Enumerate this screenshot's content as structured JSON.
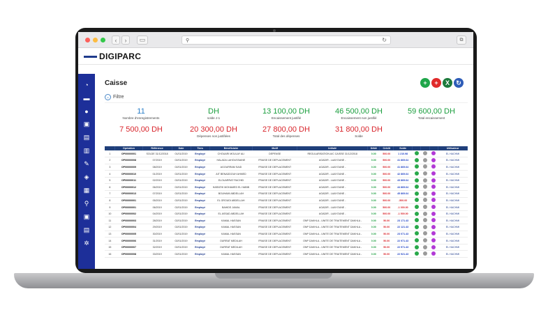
{
  "browser": {
    "url": "",
    "reload_icon": "reload-icon"
  },
  "app": {
    "brand": "DIGIPARC"
  },
  "sidebar": {
    "items": [
      {
        "icon": "dashboard-icon",
        "glyph": "◔"
      },
      {
        "icon": "car-icon",
        "glyph": "▬"
      },
      {
        "icon": "user-icon",
        "glyph": "●"
      },
      {
        "icon": "bus-icon",
        "glyph": "▣"
      },
      {
        "icon": "document-icon",
        "glyph": "▤"
      },
      {
        "icon": "fuel-icon",
        "glyph": "▥"
      },
      {
        "icon": "wrench-icon",
        "glyph": "✎"
      },
      {
        "icon": "layers-icon",
        "glyph": "◈"
      },
      {
        "icon": "building-icon",
        "glyph": "▦"
      },
      {
        "icon": "location-icon",
        "glyph": "⚲"
      },
      {
        "icon": "vehicle-icon",
        "glyph": "▣"
      },
      {
        "icon": "report-icon",
        "glyph": "▤"
      },
      {
        "icon": "settings-icon",
        "glyph": "✲"
      }
    ]
  },
  "page": {
    "title": "Caisse",
    "filter_label": "Filtre"
  },
  "actions": [
    {
      "icon": "add-icon",
      "glyph": "+",
      "color": "#1fa64a"
    },
    {
      "icon": "add-expense-icon",
      "glyph": "+",
      "color": "#e02a2a"
    },
    {
      "icon": "excel-icon",
      "glyph": "X",
      "color": "#1d7a3c"
    },
    {
      "icon": "refresh-icon",
      "glyph": "↻",
      "color": "#2e5db8"
    }
  ],
  "stats_row1": [
    {
      "value": "11",
      "label": "Nombre d'enregistrements",
      "color": "#2a7fc9"
    },
    {
      "value": "DH",
      "label": "solde J-1",
      "color": "#1b9e3e"
    },
    {
      "value": "13 100,00 DH",
      "label": "Encaissement justifié",
      "color": "#1b9e3e"
    },
    {
      "value": "46 500,00 DH",
      "label": "Encaissement non justifié",
      "color": "#1b9e3e"
    },
    {
      "value": "59 600,00 DH",
      "label": "Total encaissement",
      "color": "#1b9e3e"
    }
  ],
  "stats_row2": [
    {
      "value": "7 500,00 DH",
      "label": "",
      "color": "#d8232a"
    },
    {
      "value": "20 300,00 DH",
      "label": "Dépenses non justifiées",
      "color": "#d8232a"
    },
    {
      "value": "27 800,00 DH",
      "label": "Total des dépenses",
      "color": "#d8232a"
    },
    {
      "value": "31 800,00 DH",
      "label": "Solde",
      "color": "#d8232a"
    }
  ],
  "table": {
    "headers": [
      "",
      "Opération",
      "Référence",
      "Date",
      "Tiers",
      "Bénéficiaire",
      "Motif",
      "Intitulé",
      "Débit",
      "Crédit",
      "Solde",
      "",
      "",
      "",
      "Utilisateur"
    ],
    "rows": [
      [
        "1",
        "OP00000001",
        "SOLDE 31/12/2018",
        "01/01/2019",
        "Employé",
        "CHOUARI MOULAY ALI",
        "DEPENSE",
        "REGULARISATION A/C CAISSE 31/12/2018",
        "0.00",
        "500.00",
        "1 210.98",
        "EL HACHMI"
      ],
      [
        "2",
        "OP00000008",
        "07/2019",
        "02/01/2019",
        "Employé",
        "HALADA LAHOUSSAINE",
        "FRAISE DE DEPLACEMENT",
        "AGADIR - LAAYOUNE -",
        "0.00",
        "500.00",
        "41 869.64",
        "EL HACHMI"
      ],
      [
        "3",
        "OP00000009",
        "08/2019",
        "02/01/2019",
        "Employé",
        "AGOURRAM SAID",
        "FRAISE DE DEPLACEMENT",
        "AGADIR - LAAYOUNE -",
        "0.00",
        "500.00",
        "41 869.64",
        "EL HACHMI"
      ],
      [
        "4",
        "OP00000010",
        "01/2019",
        "02/01/2019",
        "Employé",
        "AIT BENADDOUH AHMED",
        "FRAISE DE DEPLACEMENT",
        "AGADIR - LAAYOUNE -",
        "0.00",
        "500.00",
        "42 869.64",
        "EL HACHMI"
      ],
      [
        "5",
        "OP00000011",
        "02/2019",
        "02/01/2019",
        "Employé",
        "ELOUARRAT RACHID",
        "FRAISE DE DEPLACEMENT",
        "AGADIR - LAAYOUNE -",
        "0.00",
        "500.00",
        "43 869.64",
        "EL HACHMI"
      ],
      [
        "6",
        "OP00000012",
        "06/2019",
        "02/01/2019",
        "Employé",
        "HARATHI MOHAMED EL HABIB",
        "FRAISE DE DEPLACEMENT",
        "AGADIR - LAAYOUNE -",
        "0.00",
        "500.00",
        "44 869.64",
        "EL HACHMI"
      ],
      [
        "7",
        "OP00000013",
        "07/2019",
        "02/01/2019",
        "Employé",
        "BOUHAMI ABDELLAH",
        "FRAISE DE DEPLACEMENT",
        "AGADIR - LAAYOUNE -",
        "0.00",
        "500.00",
        "45 869.64",
        "EL HACHMI"
      ],
      [
        "8",
        "OP00000001",
        "05/2019",
        "02/01/2019",
        "Employé",
        "EL GROUDI ABDELLAH",
        "FRAISE DE DEPLACEMENT",
        "AGADIR - LAAYOUNE -",
        "0.00",
        "500.00",
        "-500.00",
        "EL HACHMI"
      ],
      [
        "9",
        "OP00000001",
        "06/2019",
        "02/01/2019",
        "Employé",
        "BAHIDS JAMAL",
        "FRAISE DE DEPLACEMENT",
        "AGADIR - LAAYOUNE -",
        "0.00",
        "500.00",
        "-1 000.00",
        "EL HACHMI"
      ],
      [
        "10",
        "OP00000002",
        "04/2019",
        "02/01/2019",
        "Employé",
        "EL ASSAD ABDELLAH",
        "FRAISE DE DEPLACEMENT",
        "AGADIR - LAAYOUNE -",
        "0.00",
        "500.00",
        "-1 500.00",
        "EL HACHMI"
      ],
      [
        "11",
        "OP00000003",
        "28/2019",
        "02/01/2019",
        "Employé",
        "KAMAL HASSAN",
        "FRAISE DE DEPLACEMENT",
        "ONP DAKHLA - UNITE DE TRAITEMENT DAKHLA -",
        "0.00",
        "50.00",
        "23 171.43",
        "EL HACHMI"
      ],
      [
        "12",
        "OP00000004",
        "29/2019",
        "02/01/2019",
        "Employé",
        "KAMAL HASSAN",
        "FRAISE DE DEPLACEMENT",
        "ONP DAKHLA - UNITE DE TRAITEMENT DAKHLA -",
        "0.00",
        "50.00",
        "22 121.43",
        "EL HACHMI"
      ],
      [
        "13",
        "OP00000005",
        "30/2019",
        "02/01/2019",
        "Employé",
        "KAMAL HASSAN",
        "FRAISE DE DEPLACEMENT",
        "ONP DAKHLA - UNITE DE TRAITEMENT DAKHLA -",
        "0.00",
        "50.00",
        "23 071.43",
        "EL HACHMI"
      ],
      [
        "14",
        "OP00000006",
        "31/2019",
        "02/01/2019",
        "Employé",
        "OURRAT MEDILAH",
        "FRAISE DE DEPLACEMENT",
        "ONP DAKHLA - UNITE DE TRAITEMENT DAKHLA -",
        "0.00",
        "50.00",
        "22 971.43",
        "EL HACHMI"
      ],
      [
        "15",
        "OP00000007",
        "32/2019",
        "02/01/2019",
        "Employé",
        "OURRAT MEDILAH",
        "FRAISE DE DEPLACEMENT",
        "ONP DAKHLA - UNITE DE TRAITEMENT DAKHLA -",
        "0.00",
        "50.00",
        "22 971.43",
        "EL HACHMI"
      ],
      [
        "16",
        "OP00000008",
        "33/2019",
        "02/01/2019",
        "Employé",
        "KAMAL HASSAN",
        "FRAISE DE DEPLACEMENT",
        "ONP DAKHLA - UNITE DE TRAITEMENT DAKHLA -",
        "0.00",
        "50.00",
        "22 921.43",
        "EL HACHMI"
      ]
    ]
  }
}
